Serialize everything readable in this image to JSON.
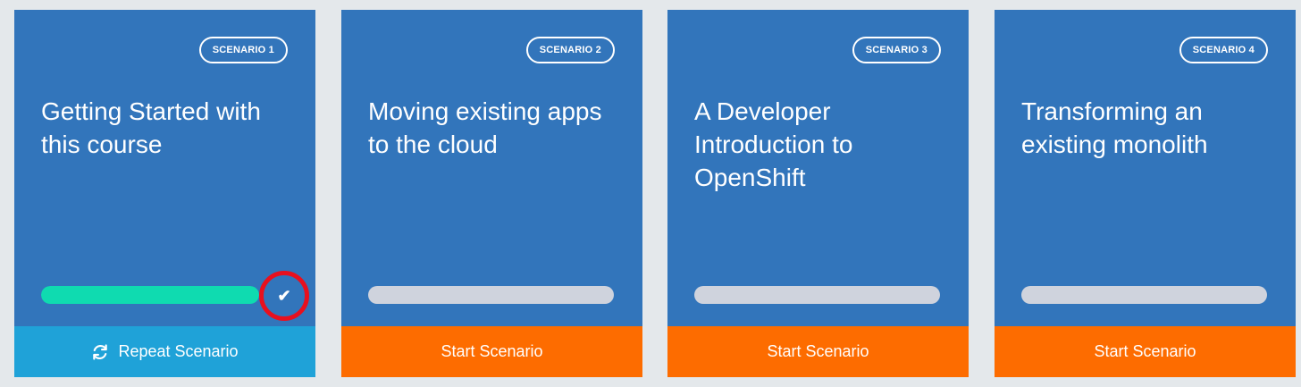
{
  "colors": {
    "background": "#e4e8eb",
    "card": "#3275bb",
    "progress_complete": "#0fdbb0",
    "progress_empty": "#cfd3dd",
    "repeat_button": "#1fa2d8",
    "start_button": "#fd6c00",
    "highlight_ring": "#e8101e"
  },
  "scenarios": [
    {
      "badge": "SCENARIO 1",
      "title": "Getting Started with this course",
      "progress": 1.0,
      "completed": true,
      "completed_icon": "checkmark-icon",
      "action_icon": "refresh-icon",
      "action_label": "Repeat Scenario"
    },
    {
      "badge": "SCENARIO 2",
      "title": "Moving existing apps to the cloud",
      "progress": 0,
      "completed": false,
      "action_label": "Start Scenario"
    },
    {
      "badge": "SCENARIO 3",
      "title": "A Developer Introduction to OpenShift",
      "progress": 0,
      "completed": false,
      "action_label": "Start Scenario"
    },
    {
      "badge": "SCENARIO 4",
      "title": "Transforming an existing monolith",
      "progress": 0,
      "completed": false,
      "action_label": "Start Scenario"
    }
  ]
}
